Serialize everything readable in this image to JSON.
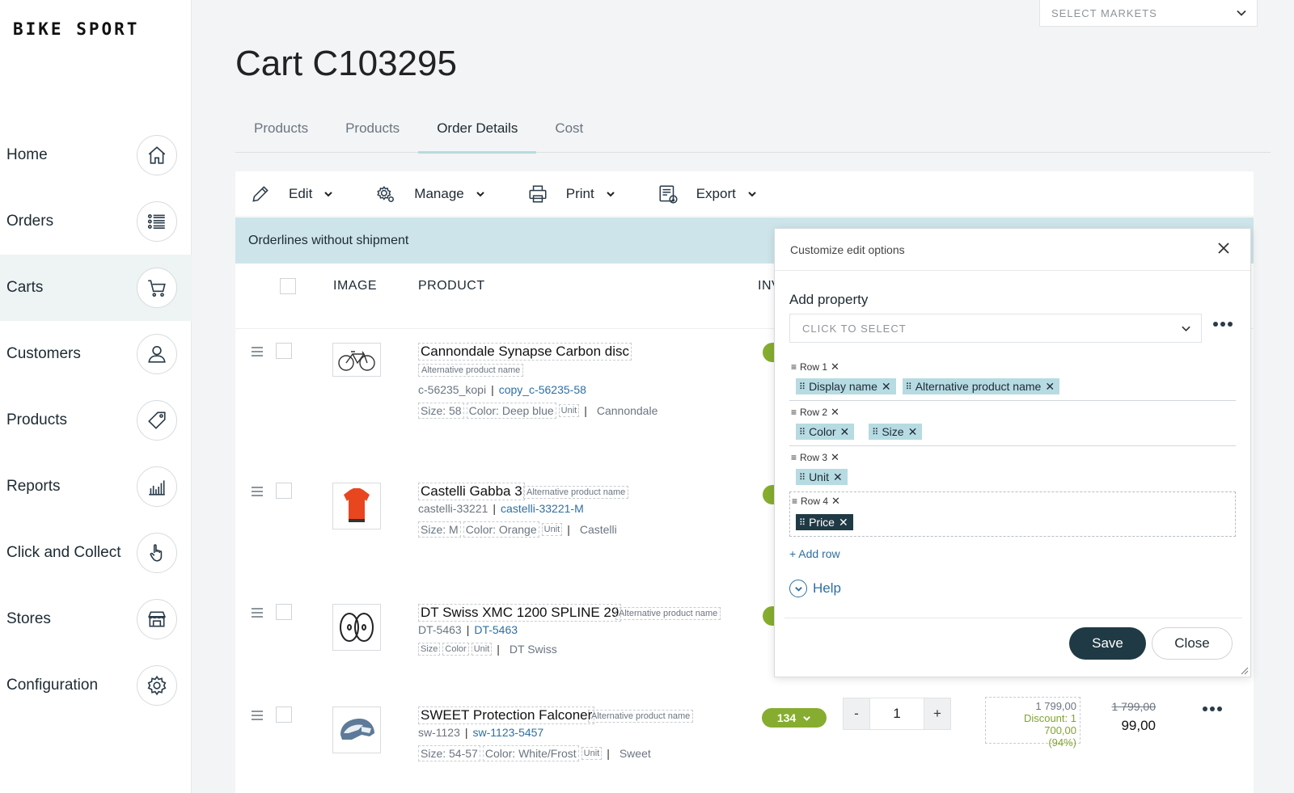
{
  "brand": "BIKE SPORT",
  "market_select": {
    "placeholder": "SELECT MARKETS",
    "icon": "chevron-down-icon"
  },
  "nav": [
    {
      "label": "Home",
      "icon": "home-icon"
    },
    {
      "label": "Orders",
      "icon": "list-icon"
    },
    {
      "label": "Carts",
      "icon": "cart-icon",
      "active": true
    },
    {
      "label": "Customers",
      "icon": "user-icon"
    },
    {
      "label": "Products",
      "icon": "tag-icon"
    },
    {
      "label": "Reports",
      "icon": "bar-chart-icon"
    },
    {
      "label": "Click and Collect",
      "icon": "hand-pointer-icon"
    },
    {
      "label": "Stores",
      "icon": "store-icon"
    },
    {
      "label": "Configuration",
      "icon": "gear-icon"
    }
  ],
  "page_title": "Cart C103295",
  "tabs": [
    {
      "label": "Products"
    },
    {
      "label": "Products"
    },
    {
      "label": "Order Details",
      "active": true
    },
    {
      "label": "Cost"
    }
  ],
  "toolbar": {
    "edit": "Edit",
    "manage": "Manage",
    "print": "Print",
    "export": "Export"
  },
  "section_title": "Orderlines without shipment",
  "columns": {
    "image": "IMAGE",
    "product": "PRODUCT",
    "inventory_partial": "INV"
  },
  "products": [
    {
      "name": "Cannondale Synapse Carbon disc",
      "alt_name": "Alternative product name",
      "sku": "c-56235_kopi",
      "variant": "copy_c-56235-58",
      "size": "Size: 58",
      "color": "Color: Deep blue",
      "unit": "Unit",
      "brand": "Cannondale",
      "image": "bicycle-image"
    },
    {
      "name": "Castelli Gabba 3",
      "alt_name": "Alternative product name",
      "sku": "castelli-33221",
      "variant": "castelli-33221-M",
      "size": "Size: M",
      "color": "Color: Orange",
      "unit": "Unit",
      "brand": "Castelli",
      "image": "jersey-image"
    },
    {
      "name": "DT Swiss XMC 1200 SPLINE 29",
      "alt_name": "Alternative product name",
      "sku": "DT-5463",
      "variant": "DT-5463",
      "size": "Size",
      "color": "Color",
      "unit": "Unit",
      "brand": "DT Swiss",
      "image": "wheels-image"
    },
    {
      "name": "SWEET Protection Falconer",
      "alt_name": "Alternative product name",
      "sku": "sw-1123",
      "variant": "sw-1123-5457",
      "size": "Size: 54-57",
      "color": "Color: White/Frost",
      "unit": "Unit",
      "brand": "Sweet",
      "image": "helmet-image",
      "stock": "134",
      "quantity": "1",
      "qty_minus": "-",
      "qty_plus": "+",
      "price_original": "1 799,00",
      "discount_label": "Discount:",
      "discount_value": "1 700,00",
      "discount_percent": "(94%)",
      "price_strike": "1 799,00",
      "price_final": "99,00"
    }
  ],
  "modal": {
    "title": "Customize edit options",
    "add_property_label": "Add property",
    "select_placeholder": "CLICK TO SELECT",
    "rows": [
      {
        "label": "Row 1",
        "chips": [
          "Display name",
          "Alternative product name"
        ]
      },
      {
        "label": "Row 2",
        "chips": [
          "Color",
          "Size"
        ]
      },
      {
        "label": "Row 3",
        "chips": [
          "Unit"
        ]
      },
      {
        "label": "Row 4",
        "chips": [
          "Price"
        ]
      }
    ],
    "add_row": "+ Add row",
    "help": "Help",
    "save": "Save",
    "close": "Close"
  },
  "colors": {
    "accent_dark": "#1f3a45",
    "section_bar": "#cde5ea",
    "chip": "#b7dbe2",
    "stock_green": "#86ad2f",
    "link_blue": "#2e6fa3"
  }
}
